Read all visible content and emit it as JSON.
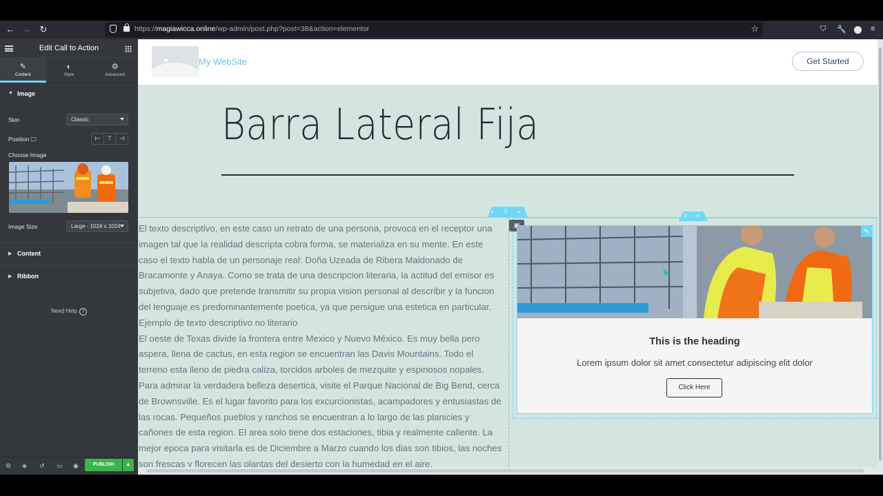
{
  "browser": {
    "url_prefix": "https://",
    "url_domain": "magiawicca.online",
    "url_path": "/wp-admin/post.php?post=38&action=elementor"
  },
  "panel": {
    "title": "Edit Call to Action",
    "tabs": [
      {
        "label": "Content",
        "icon": "pencil-icon",
        "glyph": "✎"
      },
      {
        "label": "Style",
        "icon": "half-circle-icon",
        "glyph": "◐"
      },
      {
        "label": "Advanced",
        "icon": "gear-icon",
        "glyph": "⚙"
      }
    ],
    "section_image": "Image",
    "skin_label": "Skin",
    "skin_value": "Classic",
    "position_label": "Position",
    "position_options": [
      "⊢",
      "⊤",
      "⊣"
    ],
    "choose_image_label": "Choose Image",
    "image_size_label": "Image Size",
    "image_size_value": "Large - 1024 x 1024",
    "section_content": "Content",
    "section_ribbon": "Ribbon",
    "need_help": "Need Help",
    "publish": "PUBLISH"
  },
  "site": {
    "name": "My WebSite",
    "cta_header": "Get Started",
    "hero_title": "Barra Lateral Fija",
    "body_text": "El texto descriptivo, en este caso un retrato de una persona, provoca en el receptor una imagen tal que la realidad descripta cobra forma, se materializa en su mente. En este caso el texto habla de un personaje real: Doña Uzeada de Ribera Maldonado de Bracamonte y Anaya. Como se trata de una descripcion literaria, la actitud del emisor es subjetiva, dado que pretende transmitir su propia vision personal al describir y la funcion del lenguaje es predominantemente poetica, ya que persigue una estetica en particular.",
    "body_text_2": "Ejemplo de texto descriptivo no literario",
    "body_text_3": "El oeste de Texas divide la frontera entre Mexico y Nuevo México. Es muy bella pero aspera, llena de cactus, en esta region se encuentran las Davis Mountains. Todo el terreno esta lleno de piedra caliza, torcidos arboles de mezquite y espinosos nopales. Para admirar la verdadera belleza desertica, visite el Parque Nacional de Big Bend, cerca de Brownsville. Es el lugar favorito para los excurcionistas, acampadores y entusiastas de las rocas. Pequeños pueblos y ranchos se encuentran a lo largo de las planicies y cañones de esta region. El area solo tiene dos estaciones, tibia y realmente caliente. La mejor epoca para visitarla es de Diciembre a Marzo cuando los dias son tibios, las noches son frescas y florecen las plantas del desierto con la humedad en el aire."
  },
  "cta": {
    "heading": "This is the heading",
    "description": "Lorem ipsum dolor sit amet consectetur adipiscing elit dolor",
    "button": "Click Here"
  },
  "colors": {
    "accent": "#71d7f7",
    "publish": "#39b54a",
    "preview_bg": "#d4e5df",
    "panel_bg": "#34383c"
  }
}
